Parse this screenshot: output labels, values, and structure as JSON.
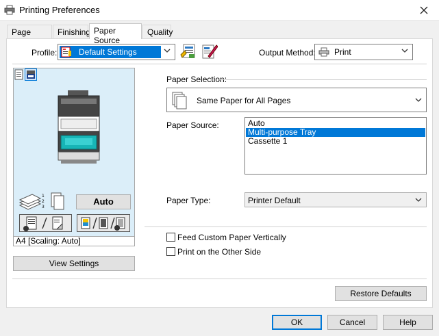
{
  "window": {
    "title": "Printing Preferences"
  },
  "tabs": [
    {
      "label": "Page Setup"
    },
    {
      "label": "Finishing"
    },
    {
      "label": "Paper Source"
    },
    {
      "label": "Quality"
    }
  ],
  "active_tab": "Paper Source",
  "profile": {
    "label": "Profile:",
    "value": "Default Settings"
  },
  "output_method": {
    "label": "Output Method:",
    "value": "Print"
  },
  "preview": {
    "auto_button": "Auto",
    "status_text": "A4 [Scaling: Auto]",
    "view_settings_button": "View Settings"
  },
  "paper_selection": {
    "label": "Paper Selection:",
    "value": "Same Paper for All Pages"
  },
  "paper_source": {
    "label": "Paper Source:",
    "options": [
      "Auto",
      "Multi-purpose Tray",
      "Cassette 1"
    ],
    "selected": "Multi-purpose Tray"
  },
  "paper_type": {
    "label": "Paper Type:",
    "value": "Printer Default"
  },
  "options": {
    "feed_custom": "Feed Custom Paper Vertically",
    "print_other_side": "Print on the Other Side"
  },
  "buttons": {
    "restore_defaults": "Restore Defaults",
    "ok": "OK",
    "cancel": "Cancel",
    "help": "Help"
  },
  "colors": {
    "selection": "#0078d7",
    "preview_bg": "#dbeef9",
    "printer_teal": "#17b5b6"
  }
}
